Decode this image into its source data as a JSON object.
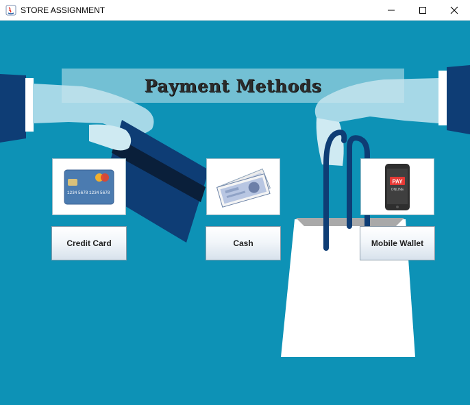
{
  "window": {
    "title": "STORE ASSIGNMENT"
  },
  "heading": {
    "text": "Payment Methods"
  },
  "methods": [
    {
      "label": "Credit Card",
      "image": "credit-card-image"
    },
    {
      "label": "Cash",
      "image": "banknotes-image"
    },
    {
      "label": "Mobile Wallet",
      "image": "phone-pay-image"
    }
  ],
  "card_image": {
    "numbers": [
      "1234",
      "5678",
      "1234",
      "5678"
    ]
  },
  "phone_image": {
    "line1": "PAY",
    "line2": "ONLINE"
  },
  "colors": {
    "background": "#0d92b6",
    "dark_navy": "#0e3d75",
    "sleeve_light": "#a6d8e7"
  }
}
